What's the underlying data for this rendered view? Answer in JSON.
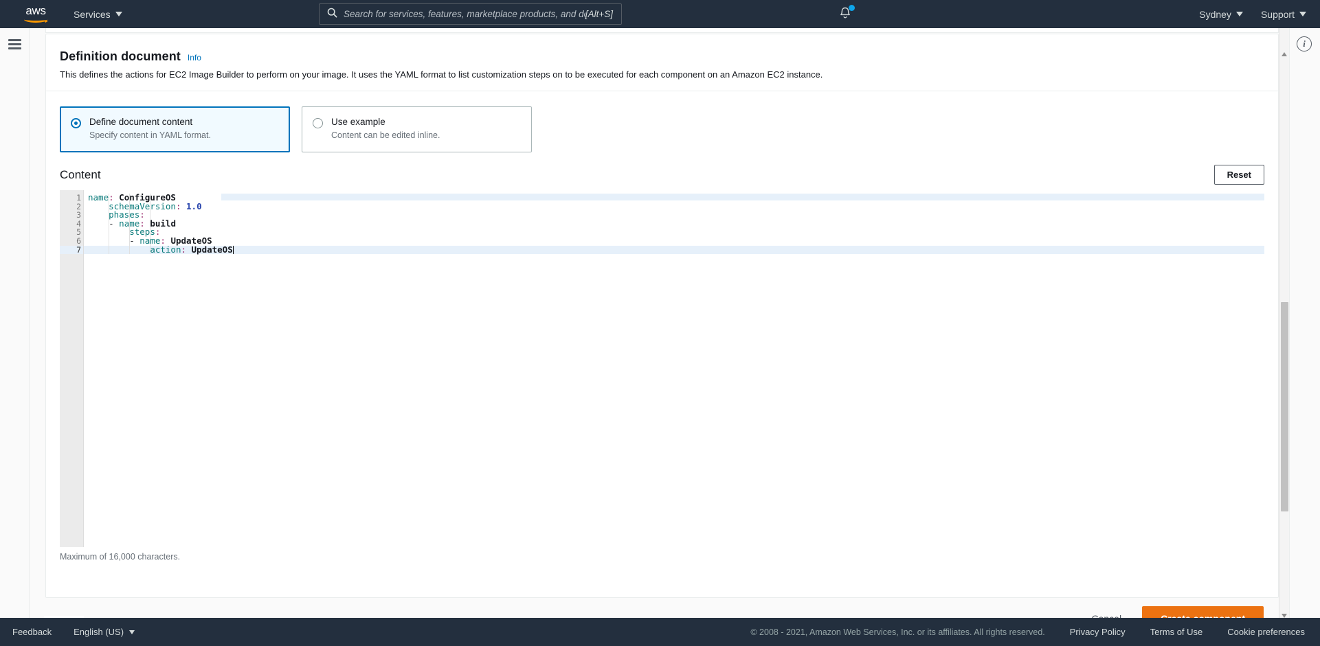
{
  "top_nav": {
    "logo_text": "aws",
    "services_label": "Services",
    "search": {
      "placeholder": "Search for services, features, marketplace products, and docs",
      "value": "",
      "shortcut": "[Alt+S]",
      "icon": "search-icon"
    },
    "notifications_icon": "bell-icon",
    "region_label": "Sydney",
    "support_label": "Support"
  },
  "rails": {
    "menu_icon": "hamburger-menu-icon",
    "info_icon": "info-circle-icon"
  },
  "card": {
    "title": "Definition document",
    "info_link": "Info",
    "description": "This defines the actions for EC2 Image Builder to perform on your image. It uses the YAML format to list customization steps on to be executed for each component on an Amazon EC2 instance.",
    "options": [
      {
        "label": "Define document content",
        "description": "Specify content in YAML format.",
        "selected": true
      },
      {
        "label": "Use example",
        "description": "Content can be edited inline.",
        "selected": false
      }
    ],
    "content_label": "Content",
    "reset_label": "Reset",
    "max_chars_note": "Maximum of 16,000 characters."
  },
  "editor": {
    "active_line": 7,
    "line_numbers": [
      "1",
      "2",
      "3",
      "4",
      "5",
      "6",
      "7"
    ],
    "lines": [
      {
        "n": 1,
        "text": "name: ConfigureOS",
        "fold": true
      },
      {
        "n": 2,
        "text": "    schemaVersion: 1.0",
        "fold": false
      },
      {
        "n": 3,
        "text": "    phases:",
        "fold": false
      },
      {
        "n": 4,
        "text": "    - name: build",
        "fold": true
      },
      {
        "n": 5,
        "text": "        steps:",
        "fold": false
      },
      {
        "n": 6,
        "text": "        - name: UpdateOS",
        "fold": true
      },
      {
        "n": 7,
        "text": "            action: UpdateOS",
        "fold": false
      }
    ],
    "raw_document": "name: ConfigureOS\n    schemaVersion: 1.0\n    phases:\n    - name: build\n        steps:\n        - name: UpdateOS\n            action: UpdateOS"
  },
  "actions": {
    "cancel_label": "Cancel",
    "create_label": "Create component"
  },
  "footer": {
    "feedback_label": "Feedback",
    "language_label": "English (US)",
    "copyright": "© 2008 - 2021, Amazon Web Services, Inc. or its affiliates. All rights reserved.",
    "links": [
      "Privacy Policy",
      "Terms of Use",
      "Cookie preferences"
    ]
  },
  "colors": {
    "nav_bg": "#232f3e",
    "accent_orange": "#ec7211",
    "link_blue": "#0073bb",
    "selected_tile_bg": "#f1faff",
    "page_bg": "#fafafa"
  }
}
